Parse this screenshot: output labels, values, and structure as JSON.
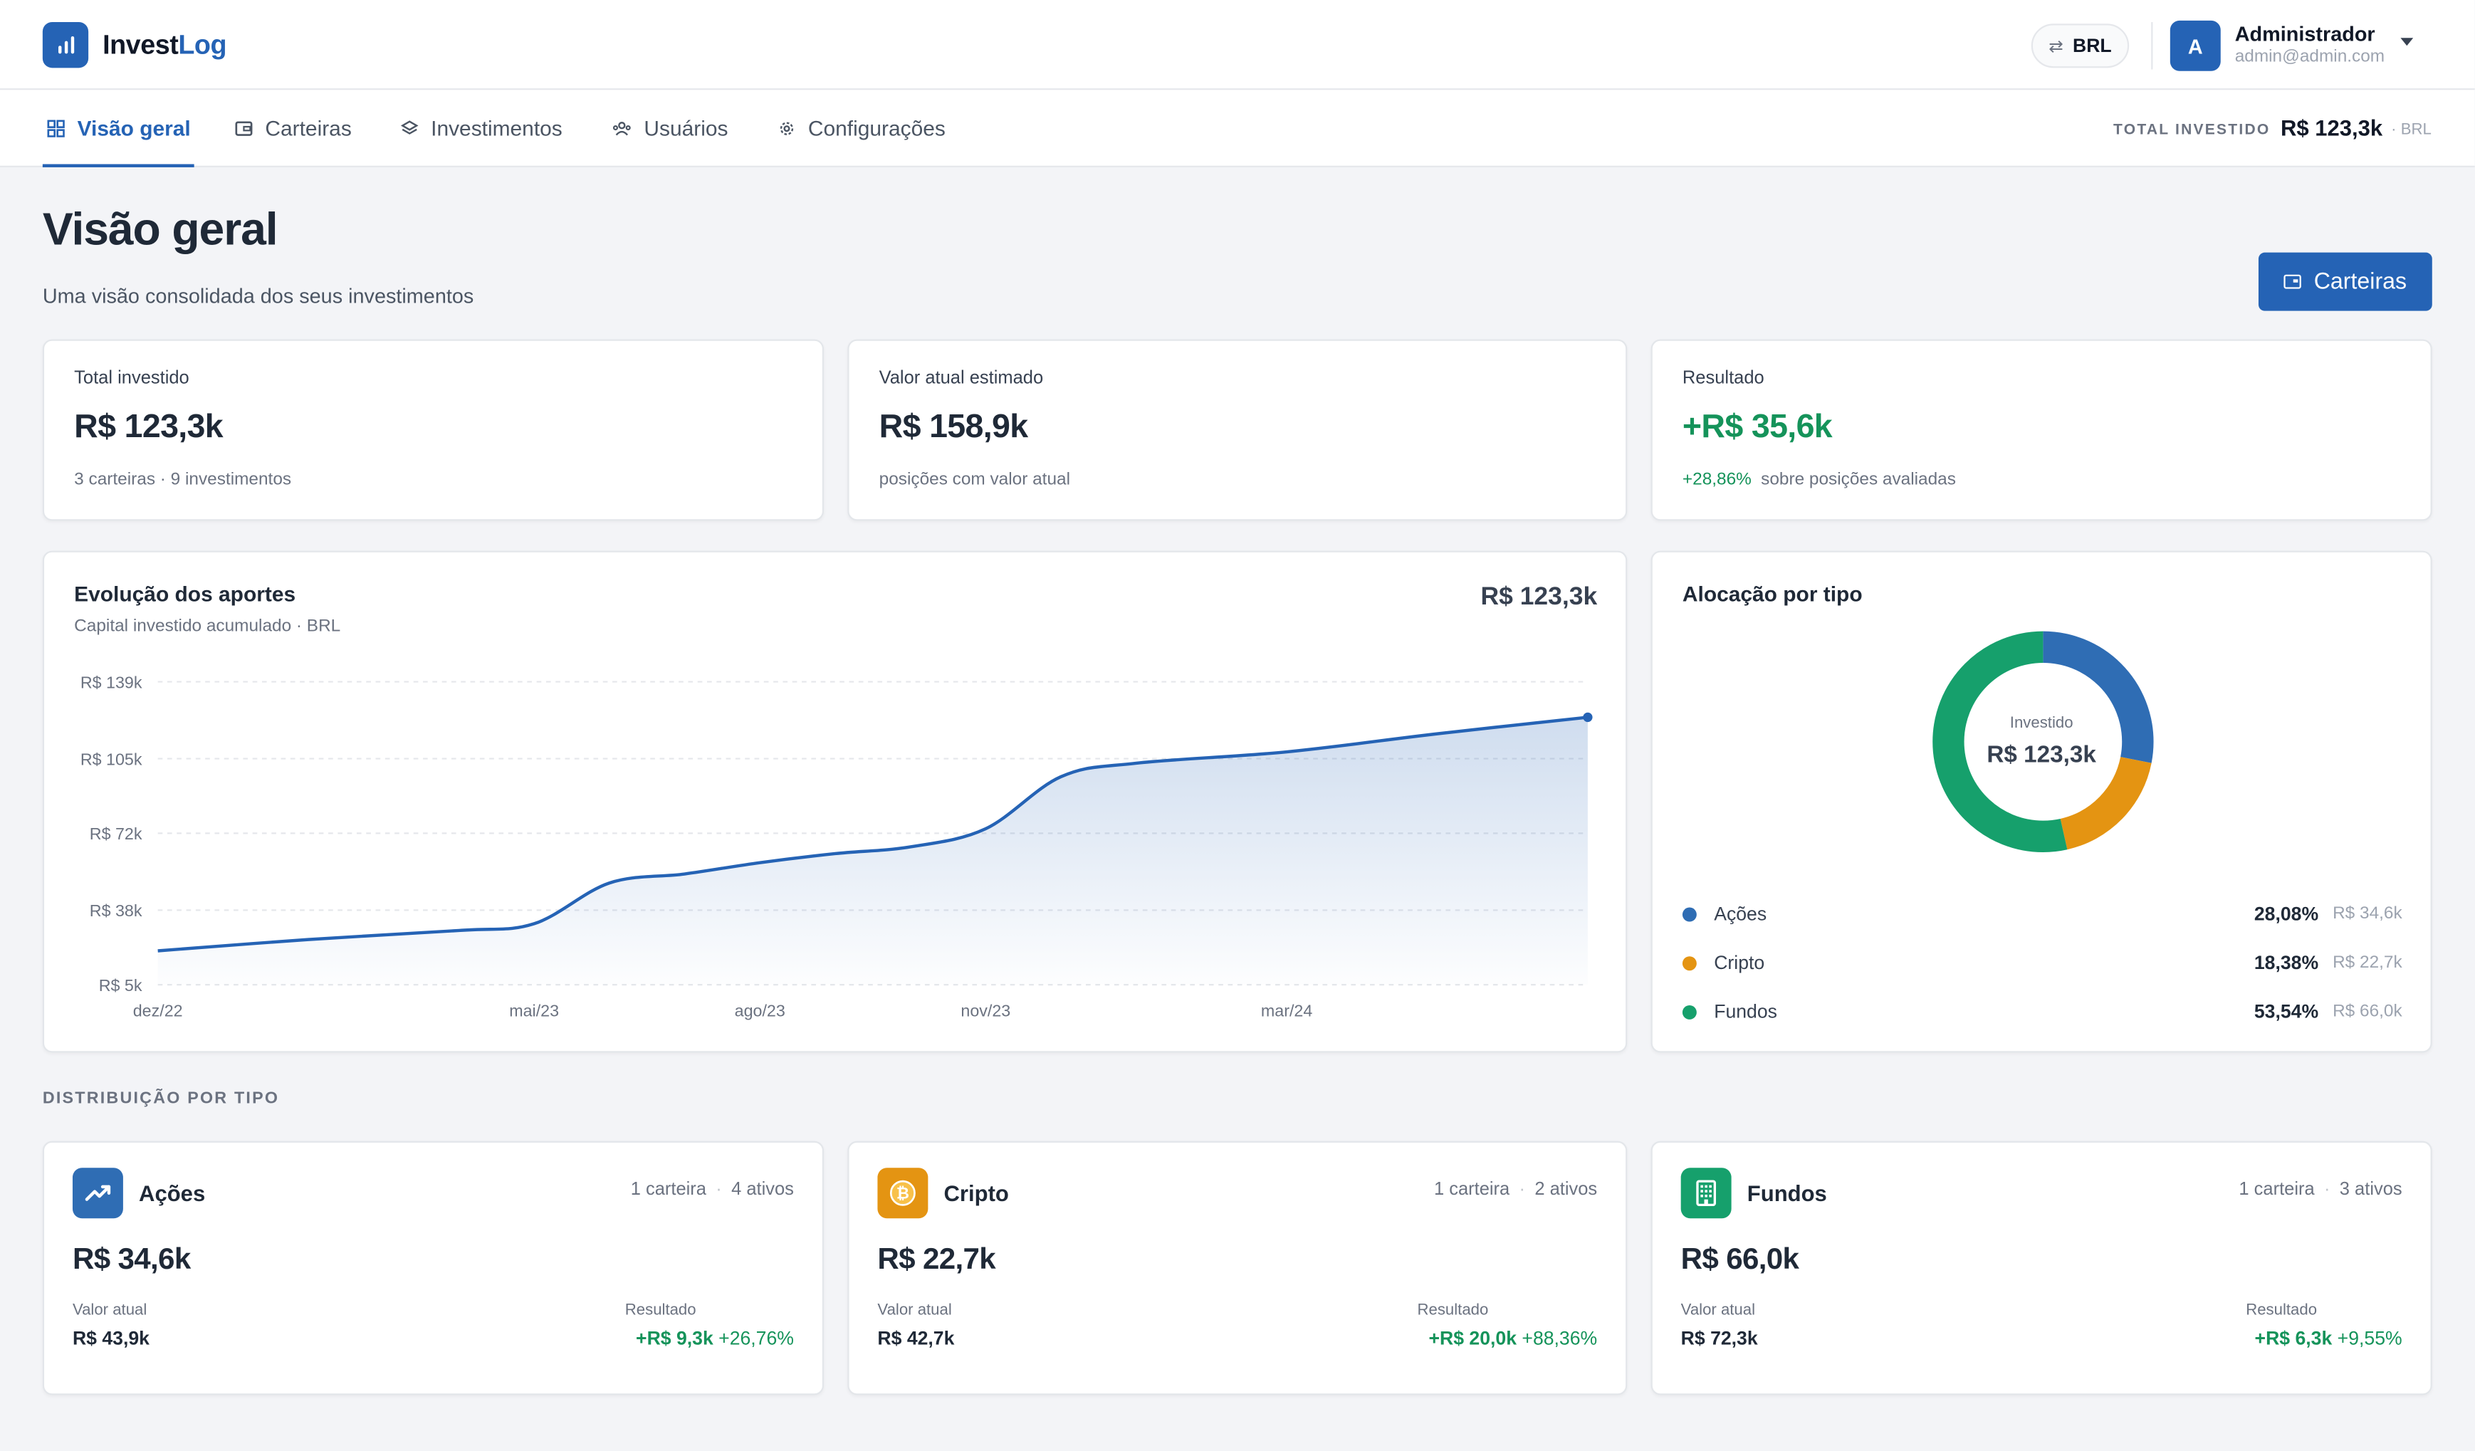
{
  "brand": {
    "name_part1": "Invest",
    "name_part2": "Log"
  },
  "header": {
    "currency": "BRL",
    "user": {
      "initial": "A",
      "name": "Administrador",
      "email": "admin@admin.com"
    }
  },
  "nav": {
    "tabs": [
      {
        "label": "Visão geral",
        "icon": "grid-icon",
        "active": true
      },
      {
        "label": "Carteiras",
        "icon": "wallet-icon",
        "active": false
      },
      {
        "label": "Investimentos",
        "icon": "layers-icon",
        "active": false
      },
      {
        "label": "Usuários",
        "icon": "users-icon",
        "active": false
      },
      {
        "label": "Configurações",
        "icon": "gear-icon",
        "active": false
      }
    ],
    "total_label": "TOTAL INVESTIDO",
    "total_value": "R$ 123,3k",
    "total_currency": "· BRL"
  },
  "page": {
    "title": "Visão geral",
    "subtitle": "Uma visão consolidada dos seus investimentos",
    "button_label": "Carteiras"
  },
  "kpis": [
    {
      "label": "Total investido",
      "value": "R$ 123,3k",
      "foot": "3 carteiras · 9 investimentos"
    },
    {
      "label": "Valor atual estimado",
      "value": "R$ 158,9k",
      "foot": "posições com valor atual"
    },
    {
      "label": "Resultado",
      "value": "+R$ 35,6k",
      "foot_pct": "+28,86%",
      "foot": "sobre posições avaliadas"
    }
  ],
  "evolution": {
    "title": "Evolução dos aportes",
    "subtitle": "Capital investido acumulado · BRL",
    "total": "R$ 123,3k"
  },
  "allocation": {
    "title": "Alocação por tipo",
    "center_label": "Investido",
    "center_value": "R$ 123,3k",
    "items": [
      {
        "name": "Ações",
        "pct": "28,08%",
        "value": "R$ 34,6k",
        "share": 28.08,
        "color": "#2f6db4"
      },
      {
        "name": "Cripto",
        "pct": "18,38%",
        "value": "R$ 22,7k",
        "share": 18.38,
        "color": "#e49412"
      },
      {
        "name": "Fundos",
        "pct": "53,54%",
        "value": "R$ 66,0k",
        "share": 53.54,
        "color": "#16a06c"
      }
    ]
  },
  "distribution": {
    "section_label": "DISTRIBUIÇÃO POR TIPO",
    "cards": [
      {
        "name": "Ações",
        "icon": "trending-up-icon",
        "color": "#2f6db4",
        "wallets": "1 carteira",
        "assets": "4 ativos",
        "value": "R$ 34,6k",
        "current_label": "Valor atual",
        "current": "R$ 43,9k",
        "result_label": "Resultado",
        "result": "+R$ 9,3k",
        "result_pct": "+26,76%"
      },
      {
        "name": "Cripto",
        "icon": "bitcoin-icon",
        "color": "#e49412",
        "wallets": "1 carteira",
        "assets": "2 ativos",
        "value": "R$ 22,7k",
        "current_label": "Valor atual",
        "current": "R$ 42,7k",
        "result_label": "Resultado",
        "result": "+R$ 20,0k",
        "result_pct": "+88,36%"
      },
      {
        "name": "Fundos",
        "icon": "building-icon",
        "color": "#16a06c",
        "wallets": "1 carteira",
        "assets": "3 ativos",
        "value": "R$ 66,0k",
        "current_label": "Valor atual",
        "current": "R$ 72,3k",
        "result_label": "Resultado",
        "result": "+R$ 6,3k",
        "result_pct": "+9,55%"
      }
    ]
  },
  "chart_data": [
    {
      "type": "area",
      "title": "Evolução dos aportes",
      "subtitle": "Capital investido acumulado · BRL",
      "y_unit": "R$ thousand",
      "ylim": [
        5,
        139
      ],
      "y_ticks": [
        {
          "value": 139,
          "label": "R$ 139k"
        },
        {
          "value": 105,
          "label": "R$ 105k"
        },
        {
          "value": 72,
          "label": "R$ 72k"
        },
        {
          "value": 38,
          "label": "R$ 38k"
        },
        {
          "value": 5,
          "label": "R$ 5k"
        }
      ],
      "x_ticks": [
        {
          "value": "2022-12",
          "label": "dez/22"
        },
        {
          "value": "2023-05",
          "label": "mai/23"
        },
        {
          "value": "2023-08",
          "label": "ago/23"
        },
        {
          "value": "2023-11",
          "label": "nov/23"
        },
        {
          "value": "2024-03",
          "label": "mar/24"
        }
      ],
      "grid": true,
      "color": "#2563b5",
      "series": [
        {
          "points": [
            {
              "x": "2022-12",
              "y": 20
            },
            {
              "x": "2023-02",
              "y": 25
            },
            {
              "x": "2023-04",
              "y": 29
            },
            {
              "x": "2023-05",
              "y": 32
            },
            {
              "x": "2023-06",
              "y": 50
            },
            {
              "x": "2023-07",
              "y": 54
            },
            {
              "x": "2023-08",
              "y": 59
            },
            {
              "x": "2023-09",
              "y": 63
            },
            {
              "x": "2023-10",
              "y": 66
            },
            {
              "x": "2023-11",
              "y": 74
            },
            {
              "x": "2023-12",
              "y": 97
            },
            {
              "x": "2024-01",
              "y": 103
            },
            {
              "x": "2024-03",
              "y": 108
            },
            {
              "x": "2024-05",
              "y": 116
            },
            {
              "x": "2024-07",
              "y": 123.3
            }
          ]
        }
      ]
    },
    {
      "type": "pie",
      "title": "Alocação por tipo",
      "donut": true,
      "categories": [
        "Ações",
        "Cripto",
        "Fundos"
      ],
      "values": [
        28.08,
        18.38,
        53.54
      ],
      "amounts": [
        "R$ 34,6k",
        "R$ 22,7k",
        "R$ 66,0k"
      ],
      "colors": [
        "#2f6db4",
        "#e49412",
        "#16a06c"
      ]
    }
  ]
}
